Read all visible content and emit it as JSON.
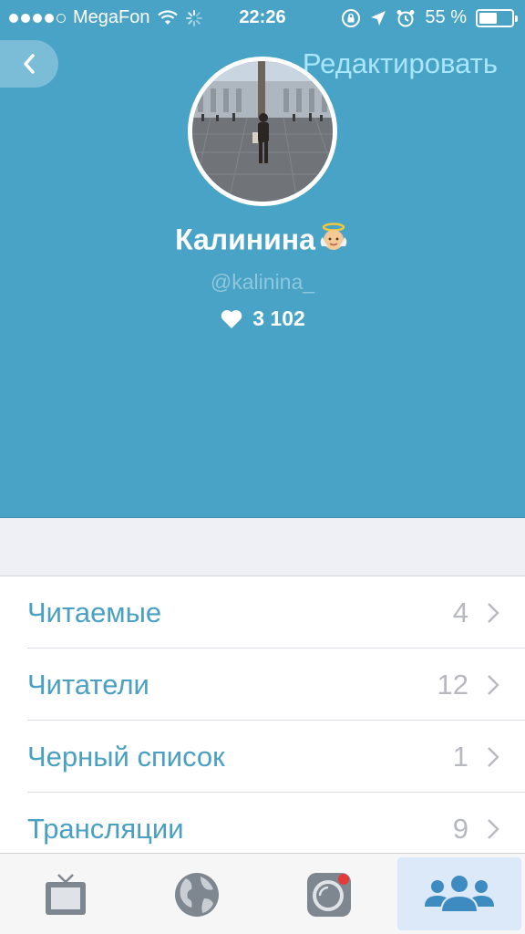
{
  "status_bar": {
    "carrier": "MegaFon",
    "time": "22:26",
    "battery_percent": "55 %",
    "battery_level": 0.55
  },
  "header": {
    "edit_label": "Редактировать",
    "back_icon": "chevron-left-icon"
  },
  "profile": {
    "name": "Калинина",
    "handle": "@kalinina_",
    "likes": "3 102",
    "emoji": "angel-emoji"
  },
  "menu": [
    {
      "label": "Читаемые",
      "count": "4"
    },
    {
      "label": "Читатели",
      "count": "12"
    },
    {
      "label": "Черный список",
      "count": "1"
    },
    {
      "label": "Трансляции",
      "count": "9"
    }
  ],
  "tabbar": {
    "tabs": [
      "tv-icon",
      "globe-icon",
      "camera-icon",
      "people-icon"
    ],
    "active_tab": 3
  },
  "colors": {
    "header_bg": "#48a3c6",
    "accent": "#4aa0c4",
    "edit_link": "#a8e6ff",
    "tab_active_bg": "#dce9f9"
  }
}
